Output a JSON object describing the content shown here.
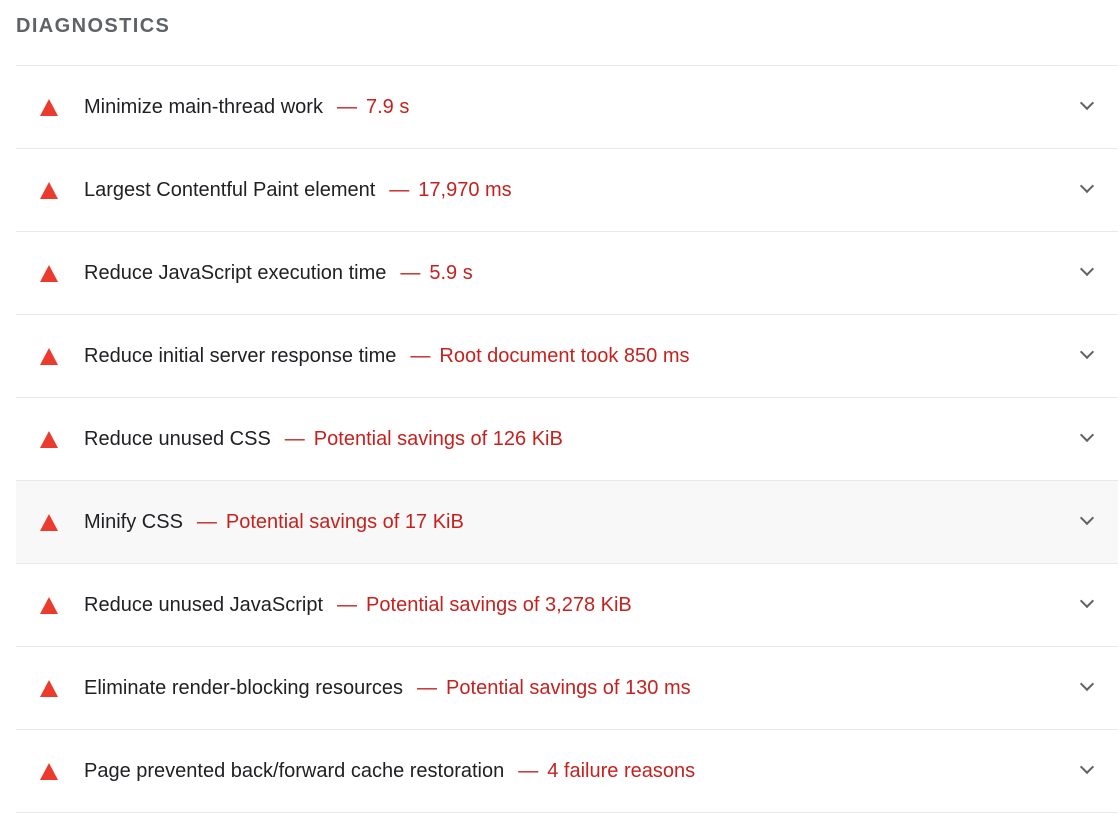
{
  "section": {
    "title": "DIAGNOSTICS"
  },
  "colors": {
    "fail": "#eb3b2e",
    "value_text": "#c5221f",
    "title_text": "#202124",
    "heading_text": "#5f6368",
    "divider": "#e8e8e8",
    "hover_background": "#f8f8f8"
  },
  "audits": [
    {
      "title": "Minimize main-thread work",
      "separator": "—",
      "value": "7.9 s",
      "icon": "fail-triangle-icon",
      "expand_icon": "chevron-down-icon"
    },
    {
      "title": "Largest Contentful Paint element",
      "separator": "—",
      "value": "17,970 ms",
      "icon": "fail-triangle-icon",
      "expand_icon": "chevron-down-icon"
    },
    {
      "title": "Reduce JavaScript execution time",
      "separator": "—",
      "value": "5.9 s",
      "icon": "fail-triangle-icon",
      "expand_icon": "chevron-down-icon"
    },
    {
      "title": "Reduce initial server response time",
      "separator": "—",
      "value": "Root document took 850 ms",
      "icon": "fail-triangle-icon",
      "expand_icon": "chevron-down-icon"
    },
    {
      "title": "Reduce unused CSS",
      "separator": "—",
      "value": "Potential savings of 126 KiB",
      "icon": "fail-triangle-icon",
      "expand_icon": "chevron-down-icon"
    },
    {
      "title": "Minify CSS",
      "separator": "—",
      "value": "Potential savings of 17 KiB",
      "icon": "fail-triangle-icon",
      "expand_icon": "chevron-down-icon",
      "hovered": true
    },
    {
      "title": "Reduce unused JavaScript",
      "separator": "—",
      "value": "Potential savings of 3,278 KiB",
      "icon": "fail-triangle-icon",
      "expand_icon": "chevron-down-icon"
    },
    {
      "title": "Eliminate render-blocking resources",
      "separator": "—",
      "value": "Potential savings of 130 ms",
      "icon": "fail-triangle-icon",
      "expand_icon": "chevron-down-icon"
    },
    {
      "title": "Page prevented back/forward cache restoration",
      "separator": "—",
      "value": "4 failure reasons",
      "icon": "fail-triangle-icon",
      "expand_icon": "chevron-down-icon"
    }
  ]
}
